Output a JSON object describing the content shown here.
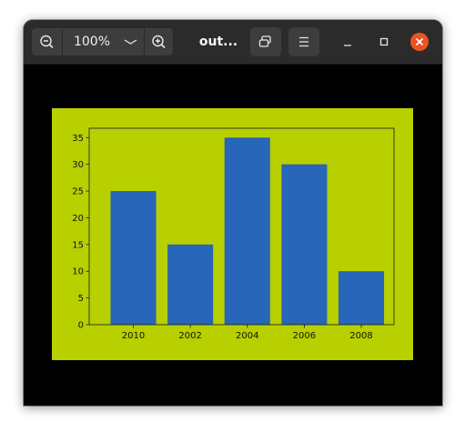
{
  "window": {
    "title": "out...",
    "zoom_level": "100%"
  },
  "icons": {
    "zoom_out": "zoom-out-icon",
    "zoom_menu": "chevron-down-icon",
    "zoom_in": "zoom-in-icon",
    "restore": "restore-window-icon",
    "menu": "hamburger-menu-icon",
    "minimize": "minimize-icon",
    "maximize": "maximize-icon",
    "close": "close-icon"
  },
  "colors": {
    "titlebar": "#2b2b2b",
    "button": "#3d3d3d",
    "viewer_background": "#000000",
    "figure_background": "#b8cf00",
    "bar": "#2766b8",
    "close": "#e95420"
  },
  "chart_data": {
    "type": "bar",
    "categories": [
      "2010",
      "2002",
      "2004",
      "2006",
      "2008"
    ],
    "values": [
      25,
      15,
      35,
      30,
      10
    ],
    "ylim": [
      0,
      36.75
    ],
    "yticks": [
      "0",
      "5",
      "10",
      "15",
      "20",
      "25",
      "30",
      "35"
    ],
    "title": "",
    "xlabel": "",
    "ylabel": "",
    "grid": false,
    "legend": "none"
  }
}
